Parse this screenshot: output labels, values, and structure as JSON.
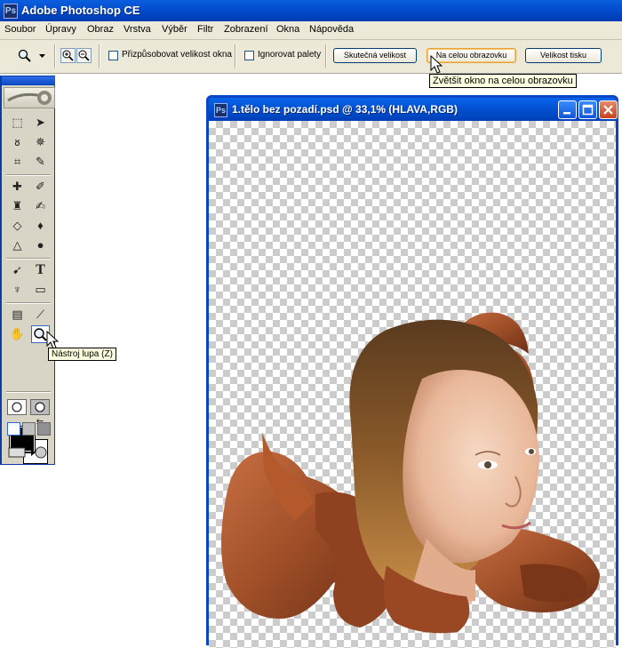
{
  "app": {
    "title": "Adobe Photoshop CE"
  },
  "menu": [
    "Soubor",
    "Úpravy",
    "Obraz",
    "Vrstva",
    "Výběr",
    "Filtr",
    "Zobrazení",
    "Okna",
    "Nápověda"
  ],
  "options": {
    "fit_window_label": "Přizpůsobovat velikost okna",
    "ignore_palettes_label": "Ignorovat palety",
    "actual_size_label": "Skutečná velikost",
    "fit_screen_label": "Na celou obrazovku",
    "print_size_label": "Velikost tisku",
    "fit_screen_tooltip": "Zvětšit okno na celou obrazovku"
  },
  "toolbox": {
    "zoom_tool_tooltip": "Nástroj lupa (Z)"
  },
  "document": {
    "title": "1.tělo bez pozadí.psd @ 33,1% (HLAVA,RGB)"
  },
  "colors": {
    "foreground": "#000000",
    "background": "#ffffff",
    "xp_title": "#0a55d8"
  }
}
